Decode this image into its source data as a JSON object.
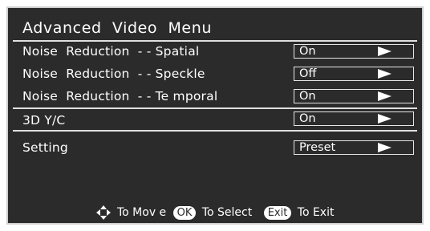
{
  "menu": {
    "title": "Advanced  Video  Menu"
  },
  "items": [
    {
      "label": "Noise  Reduction  - - Spatial",
      "value": "On"
    },
    {
      "label": "Noise  Reduction  - - Speckle",
      "value": "Off"
    },
    {
      "label": "Noise  Reduction  - - Te mporal",
      "value": "On"
    },
    {
      "label": "3D Y/C",
      "value": "On"
    },
    {
      "label": "Setting",
      "value": "Preset"
    }
  ],
  "footer": {
    "move_text": "To Mov e",
    "ok_key": "OK",
    "select_text": "To Select",
    "exit_key": "Exit",
    "exit_text": "To Exit"
  },
  "colors": {
    "panel_background": "#2b2b2b",
    "text": "#ffffff",
    "border": "#cfcfcf"
  },
  "icons": {
    "move": "four-way-arrow-icon",
    "value_arrow": "play-arrow-icon"
  }
}
